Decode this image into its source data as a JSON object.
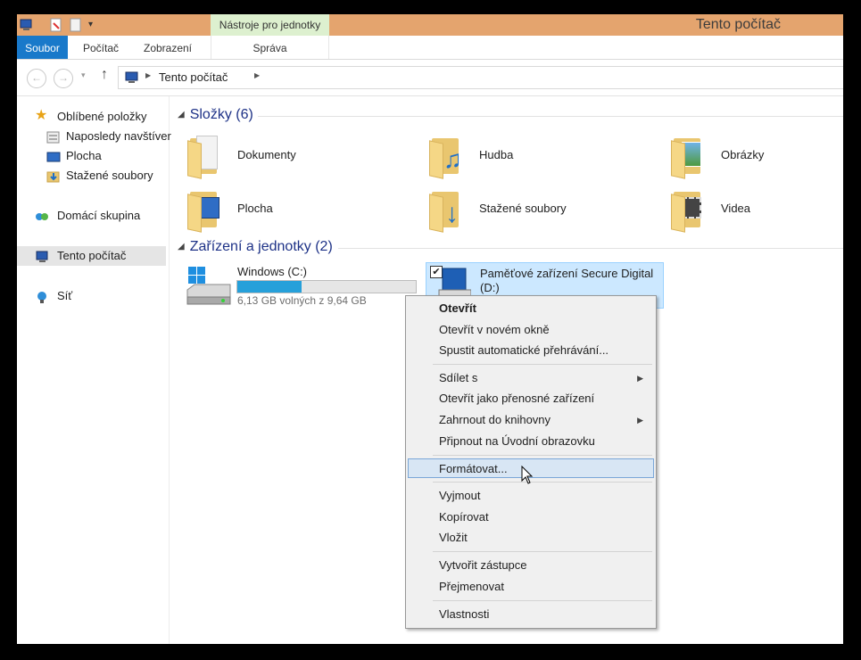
{
  "window": {
    "title": "Tento počítač",
    "contextual_tab_group": "Nástroje pro jednotky"
  },
  "ribbon": {
    "tabs": [
      {
        "label": "Soubor"
      },
      {
        "label": "Počítač"
      },
      {
        "label": "Zobrazení"
      },
      {
        "label": "Správa"
      }
    ]
  },
  "address": {
    "path": "Tento počítač"
  },
  "sidebar": {
    "favorites": "Oblíbené položky",
    "favorite_items": [
      "Naposledy navštíver",
      "Plocha",
      "Stažené soubory"
    ],
    "homegroup": "Domácí skupina",
    "this_pc": "Tento počítač",
    "network": "Síť"
  },
  "folders": {
    "header": "Složky (6)",
    "items": [
      "Dokumenty",
      "Hudba",
      "Obrázky",
      "Plocha",
      "Stažené soubory",
      "Videa"
    ]
  },
  "devices": {
    "header": "Zařízení a jednotky (2)",
    "c_drive": {
      "name": "Windows (C:)",
      "free_text": "6,13 GB volných z 9,64 GB",
      "used_fraction": 0.36
    },
    "d_drive": {
      "name_line1": "Paměťové zařízení Secure Digital",
      "name_line2": "(D:)"
    }
  },
  "context_menu": {
    "items": [
      {
        "label": "Otevřít"
      },
      {
        "label": "Otevřít v novém okně"
      },
      {
        "label": "Spustit automatické přehrávání..."
      },
      {
        "label": "Sdílet s"
      },
      {
        "label": "Otevřít jako přenosné zařízení"
      },
      {
        "label": "Zahrnout do knihovny"
      },
      {
        "label": "Připnout na Úvodní obrazovku"
      },
      {
        "label": "Formátovat..."
      },
      {
        "label": "Vyjmout"
      },
      {
        "label": "Kopírovat"
      },
      {
        "label": "Vložit"
      },
      {
        "label": "Vytvořit zástupce"
      },
      {
        "label": "Přejmenovat"
      },
      {
        "label": "Vlastnosti"
      }
    ]
  },
  "colors": {
    "accent": "#1979ca",
    "titlebar": "#e4a46e",
    "tool_tab": "#ddf0cf",
    "drive_bar": "#26a0da"
  }
}
